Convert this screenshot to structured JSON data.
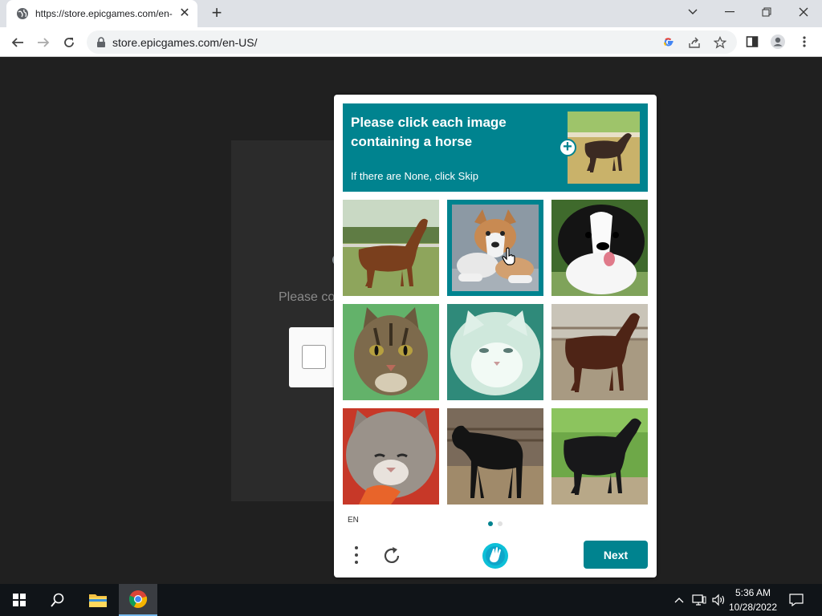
{
  "browser": {
    "tab_title": "https://store.epicgames.com/en-",
    "url": "store.epicgames.com/en-US/"
  },
  "background": {
    "text": "Please co"
  },
  "captcha": {
    "prompt_title": "Please click each image containing a horse",
    "prompt_subtitle": "If there are None, click Skip",
    "language": "EN",
    "next_label": "Next",
    "accent_color": "#00838f",
    "tiles": [
      {
        "subject": "horse",
        "selected": false
      },
      {
        "subject": "dog",
        "selected": true
      },
      {
        "subject": "dog",
        "selected": false
      },
      {
        "subject": "cat",
        "selected": false
      },
      {
        "subject": "cat",
        "selected": false
      },
      {
        "subject": "horse",
        "selected": false
      },
      {
        "subject": "cat",
        "selected": false
      },
      {
        "subject": "horse",
        "selected": false
      },
      {
        "subject": "horse",
        "selected": false
      }
    ],
    "page_dots": {
      "count": 2,
      "active": 1
    }
  },
  "taskbar": {
    "time": "5:36 AM",
    "date": "10/28/2022"
  }
}
